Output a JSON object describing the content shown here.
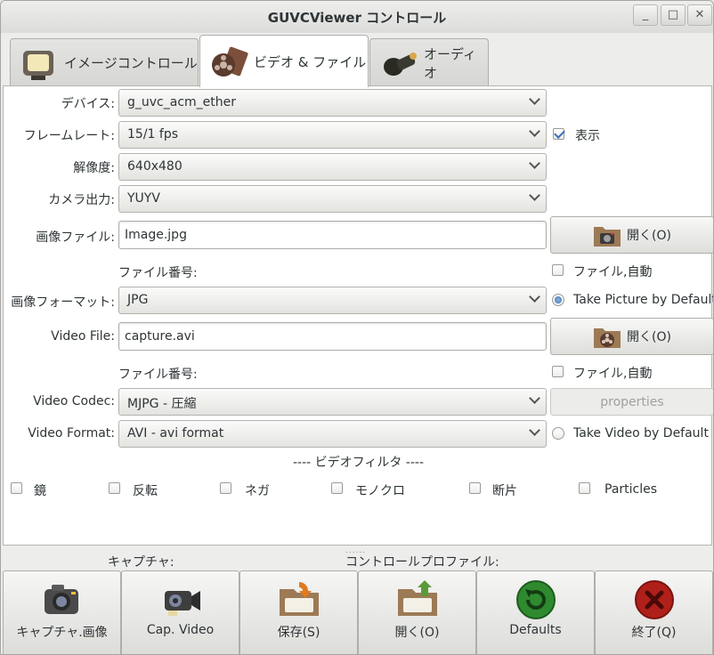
{
  "window": {
    "title": "GUVCViewer コントロール",
    "minimize_glyph": "_",
    "maximize_glyph": "□",
    "close_glyph": "✕"
  },
  "tabs": [
    {
      "label": "イメージコントロール",
      "icon": "tv-icon",
      "active": false
    },
    {
      "label": "ビデオ & ファイル",
      "icon": "film-reel-icon",
      "active": true
    },
    {
      "label": "オーディオ",
      "icon": "microphone-icon",
      "active": false
    }
  ],
  "form": {
    "device_label": "デバイス:",
    "device_value": "g_uvc_acm_ether",
    "framerate_label": "フレームレート:",
    "framerate_value": "15/1 fps",
    "show_label": "表示",
    "show_checked": true,
    "resolution_label": "解像度:",
    "resolution_value": "640x480",
    "camera_output_label": "カメラ出力:",
    "camera_output_value": "YUYV",
    "image_file_label": "画像ファイル:",
    "image_file_value": "Image.jpg",
    "image_open_label": "開く(O)",
    "image_file_number_label": "ファイル番号:",
    "image_file_auto_label": "ファイル,自動",
    "image_format_label": "画像フォーマット:",
    "image_format_value": "JPG",
    "take_picture_default_label": "Take Picture by Default",
    "video_file_label": "Video File:",
    "video_file_value": "capture.avi",
    "video_open_label": "開く(O)",
    "video_file_number_label": "ファイル番号:",
    "video_file_auto_label": "ファイル,自動",
    "video_codec_label": "Video Codec:",
    "video_codec_value": "MJPG - 圧縮",
    "properties_label": "properties",
    "video_format_label": "Video Format:",
    "video_format_value": "AVI - avi format",
    "take_video_default_label": "Take Video by Default",
    "video_filter_heading": "---- ビデオフィルタ ----",
    "filters": [
      "鏡",
      "反転",
      "ネガ",
      "モノクロ",
      "断片",
      "Particles"
    ]
  },
  "bottom": {
    "grip": "......",
    "capture_label": "キャプチャ:",
    "profile_label": "コントロールプロファイル:",
    "buttons": [
      {
        "label": "キャプチャ.画像",
        "icon": "camera-icon"
      },
      {
        "label": "Cap. Video",
        "icon": "video-camera-icon"
      },
      {
        "label": "保存(S)",
        "icon": "save-folder-icon"
      },
      {
        "label": "開く(O)",
        "icon": "open-folder-icon"
      },
      {
        "label": "Defaults",
        "icon": "reset-icon"
      },
      {
        "label": "終了(Q)",
        "icon": "quit-icon"
      }
    ]
  },
  "colors": {
    "accent": "#3a6fb7",
    "defaults_green": "#2f8a2f",
    "quit_red": "#b0201a"
  }
}
